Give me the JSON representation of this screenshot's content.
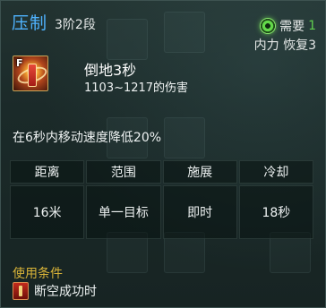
{
  "skill": {
    "name": "压制",
    "rank": "3阶2段",
    "hotkey": "F"
  },
  "requirement": {
    "label": "需要",
    "count": "1",
    "detail": "内力 恢复3",
    "icon": "green-swirl-icon"
  },
  "effect": {
    "title": "倒地3秒",
    "damage": "1103~1217的伤害",
    "slow": "在6秒内移动速度降低20%"
  },
  "stats": {
    "headers": [
      "距离",
      "范围",
      "施展",
      "冷却"
    ],
    "values": [
      "16米",
      "单一目标",
      "即时",
      "18秒"
    ]
  },
  "condition": {
    "title": "使用条件",
    "text": "断空成功时",
    "icon": "red-scroll-icon"
  },
  "colors": {
    "skill_name": "#4fb3ff",
    "requirement_count": "#61d04f",
    "condition_title": "#d8b338"
  }
}
